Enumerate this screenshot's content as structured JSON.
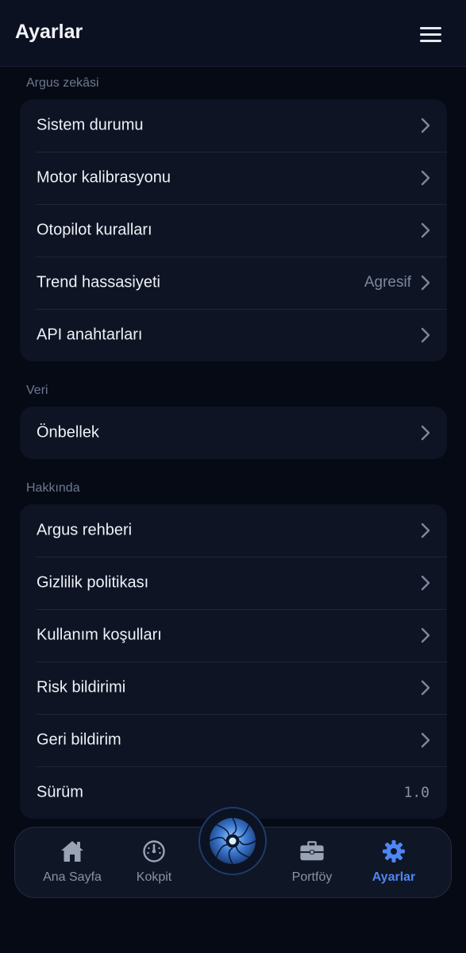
{
  "header": {
    "title": "Ayarlar"
  },
  "sections": [
    {
      "label": "Argus zekâsi",
      "items": [
        {
          "label": "Sistem durumu"
        },
        {
          "label": "Motor kalibrasyonu"
        },
        {
          "label": "Otopilot kuralları"
        },
        {
          "label": "Trend hassasiyeti",
          "value": "Agresif"
        },
        {
          "label": "API anahtarları"
        }
      ]
    },
    {
      "label": "Veri",
      "items": [
        {
          "label": "Önbellek"
        }
      ]
    },
    {
      "label": "Hakkında",
      "items": [
        {
          "label": "Argus rehberi"
        },
        {
          "label": "Gizlilik politikası"
        },
        {
          "label": "Kullanım koşulları"
        },
        {
          "label": "Risk bildirimi"
        },
        {
          "label": "Geri bildirim"
        },
        {
          "label": "Sürüm",
          "value": "1.0"
        }
      ]
    }
  ],
  "tabbar": {
    "tabs": [
      {
        "label": "Ana Sayfa",
        "icon": "house-icon"
      },
      {
        "label": "Kokpit",
        "icon": "gauge-icon"
      },
      {
        "label": "Portföy",
        "icon": "briefcase-icon"
      },
      {
        "label": "Ayarlar",
        "icon": "gear-icon",
        "active": true
      }
    ],
    "center_icon": "camera-aperture-icon"
  },
  "colors": {
    "background": "#060a14",
    "card": "#0e1424",
    "accent": "#4d86f5",
    "muted": "#8a93a6"
  }
}
